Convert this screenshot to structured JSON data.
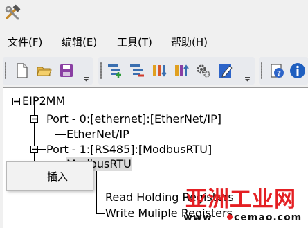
{
  "menubar": {
    "items": [
      "文件(F)",
      "编辑(E)",
      "工具(T)",
      "帮助(H)"
    ]
  },
  "toolbar": {
    "groups": [
      [
        "new-file-icon",
        "open-folder-icon",
        "save-icon"
      ],
      [
        "add-node-icon",
        "remove-node-icon",
        "import-icon",
        "export-icon",
        "settings-gear-icon",
        "edit-pencil-icon"
      ],
      [
        "help-icon",
        "info-icon"
      ]
    ]
  },
  "tree": {
    "root": "EIP2MM",
    "port0": "Port - 0:[ethernet]:[EtherNet/IP]",
    "port0_child": "EtherNet/IP",
    "port1": "Port - 1:[RS485]:[ModbusRTU]",
    "port1_child": "ModbusRTU",
    "read_holding": "Read Holding Registers",
    "write_multiple": "Write Muliple Registers"
  },
  "context_menu": {
    "insert": "插入"
  },
  "watermark": {
    "big": "亚洲工业网",
    "small_left": "www",
    "small_right": "cemao.com"
  }
}
